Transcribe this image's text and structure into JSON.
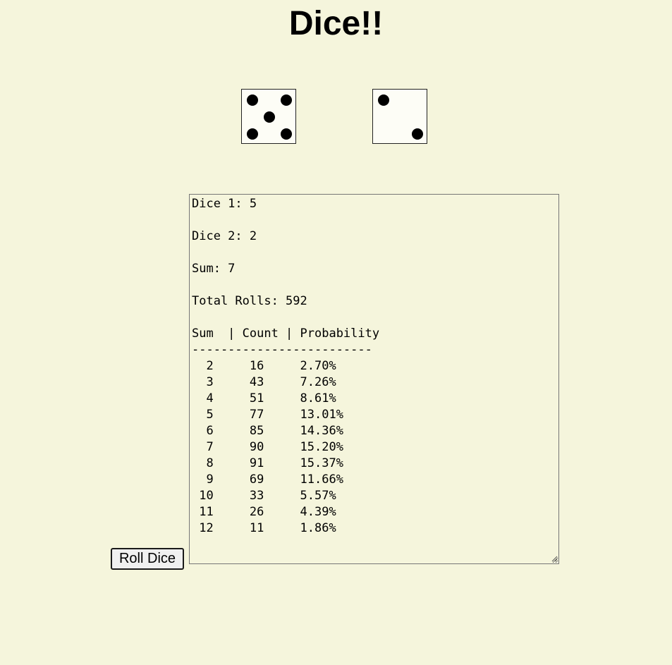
{
  "page": {
    "title": "Dice!!"
  },
  "dice": [
    {
      "value": 5
    },
    {
      "value": 2
    }
  ],
  "results": {
    "lines": [
      "Dice 1: 5",
      "",
      "Dice 2: 2",
      "",
      "Sum: 7",
      "",
      "Total Rolls: 592",
      "",
      "Sum  | Count | Probability",
      "-------------------------",
      "  2     16     2.70%",
      "  3     43     7.26%",
      "  4     51     8.61%",
      "  5     77     13.01%",
      "  6     85     14.36%",
      "  7     90     15.20%",
      "  8     91     15.37%",
      "  9     69     11.66%",
      " 10     33     5.57%",
      " 11     26     4.39%",
      " 12     11     1.86%"
    ]
  },
  "controls": {
    "roll_label": "Roll Dice"
  },
  "colors": {
    "background": "#f5f5dc",
    "pip": "#000000"
  }
}
